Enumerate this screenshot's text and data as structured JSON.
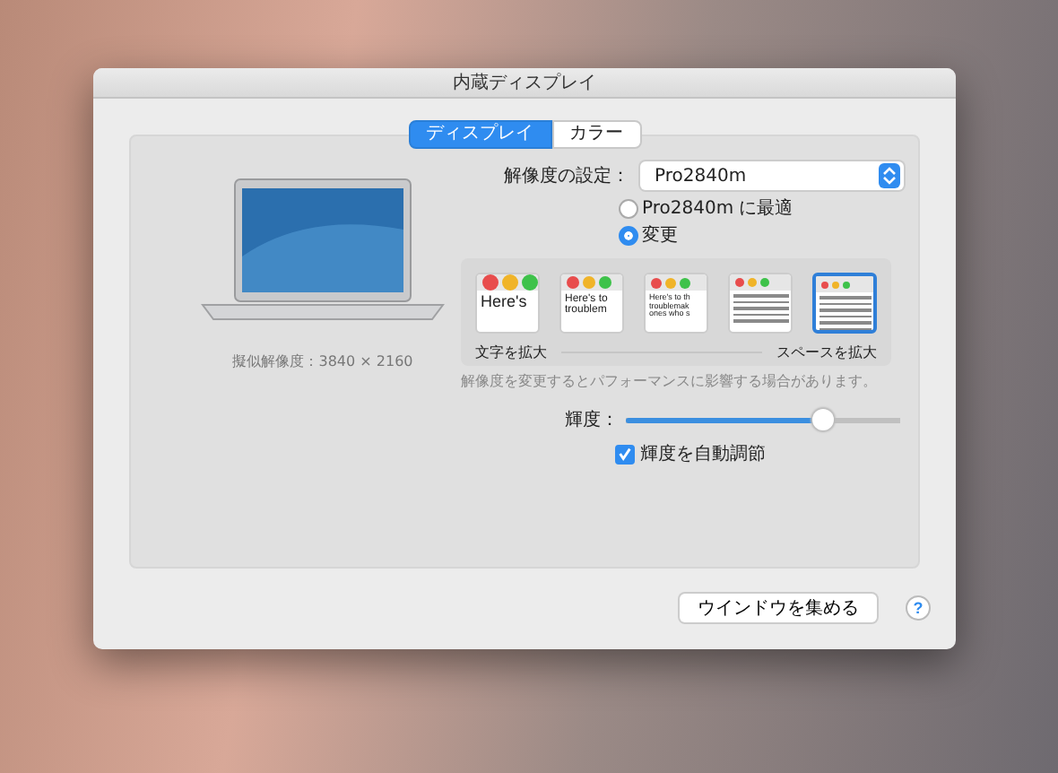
{
  "window": {
    "title": "内蔵ディスプレイ"
  },
  "tabs": [
    {
      "label": "ディスプレイ",
      "selected": true
    },
    {
      "label": "カラー",
      "selected": false
    }
  ],
  "display_preview": {
    "caption": "擬似解像度：3840 × 2160"
  },
  "resolution": {
    "label": "解像度の設定：",
    "value": "Pro2840m",
    "options": [
      {
        "label": "Pro2840m に最適",
        "selected": false
      },
      {
        "label": "変更",
        "selected": true
      }
    ]
  },
  "scaling": {
    "options": [
      {
        "selected": false,
        "preview_lines": [
          "Here's"
        ]
      },
      {
        "selected": false,
        "preview_lines": [
          "Here's to",
          "troublem"
        ]
      },
      {
        "selected": false,
        "preview_lines": [
          "Here's to th",
          "troublemak",
          "ones who s"
        ]
      },
      {
        "selected": false
      },
      {
        "selected": true
      }
    ],
    "left_label": "文字を拡大",
    "right_label": "スペースを拡大",
    "note": "解像度を変更するとパフォーマンスに影響する場合があります。"
  },
  "brightness": {
    "label": "輝度：",
    "level": 0.74
  },
  "auto_brightness": {
    "label": "輝度を自動調節",
    "checked": true
  },
  "footer": {
    "button": "ウインドウを集める",
    "help": "?"
  }
}
